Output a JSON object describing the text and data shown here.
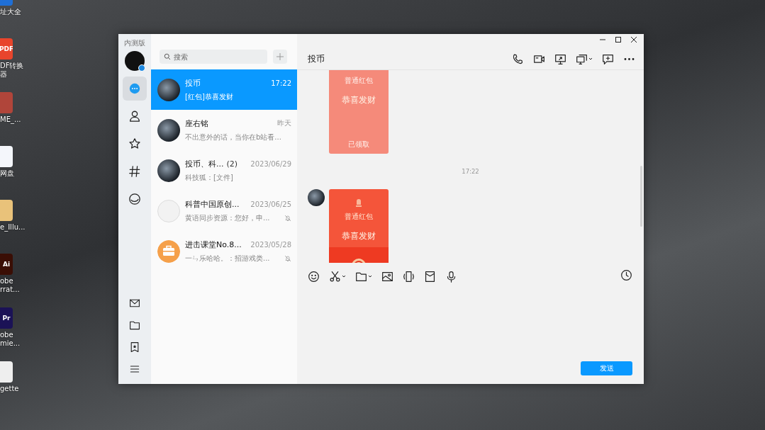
{
  "desktop": {
    "icons": [
      {
        "label": "址大全"
      },
      {
        "label": "DF转换器",
        "tile_text": "PDF"
      },
      {
        "label": "ME_..."
      },
      {
        "label": "网盘"
      },
      {
        "label": "e_Illu..."
      },
      {
        "label": "obe rrat...",
        "tile_text": "Ai"
      },
      {
        "label": "obe mie...",
        "tile_text": "Pr"
      },
      {
        "label": "gette"
      }
    ]
  },
  "window": {
    "title": "内测版"
  },
  "nav": {
    "top": [
      {
        "kind": "messages",
        "selected": true
      },
      {
        "kind": "contacts",
        "selected": false
      },
      {
        "kind": "favorites",
        "selected": false
      },
      {
        "kind": "channels",
        "selected": false
      },
      {
        "kind": "discover",
        "selected": false
      }
    ],
    "bottom": [
      {
        "kind": "mail"
      },
      {
        "kind": "folder"
      },
      {
        "kind": "bookmark"
      },
      {
        "kind": "menu"
      }
    ]
  },
  "search": {
    "placeholder": "搜索"
  },
  "chats": [
    {
      "name": "投币",
      "time": "17:22",
      "preview": "[红包]恭喜发财",
      "kind": "photo",
      "muted": false,
      "selected": true
    },
    {
      "name": "座右铭",
      "time": "昨天",
      "preview": "不出意外的话，当你在b站看...",
      "kind": "photo",
      "muted": false,
      "selected": false
    },
    {
      "name": "投币、科...",
      "count": "(2)",
      "time": "2023/06/29",
      "preview": "科技狐：[文件]",
      "kind": "photo",
      "muted": false,
      "selected": false
    },
    {
      "name": "科普中国原创...",
      "time": "2023/06/25",
      "preview": "黄语同步资源：您好，申...",
      "kind": "logo",
      "muted": true,
      "selected": false
    },
    {
      "name": "进击课堂No.8...",
      "time": "2023/05/28",
      "preview": "一ㄣ乐哈哈。：招游戏类...",
      "kind": "briefcase",
      "muted": true,
      "selected": false
    }
  ],
  "conversation": {
    "title": "投币",
    "messages": [
      {
        "kind": "red_packet",
        "cut_top": true,
        "opened": true,
        "label": "普通红包",
        "greeting": "恭喜发财",
        "status": "已领取"
      },
      {
        "kind": "time",
        "text": "17:22"
      },
      {
        "kind": "red_packet",
        "cut_top": false,
        "opened": false,
        "label": "普通红包",
        "greeting": "恭喜发财"
      }
    ],
    "send_button": "发送"
  }
}
